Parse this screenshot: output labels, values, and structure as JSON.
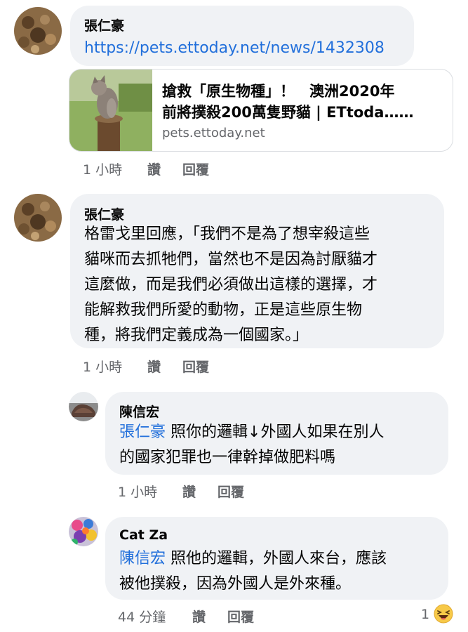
{
  "comments": [
    {
      "author": "張仁豪",
      "link": "https://pets.ettoday.net/news/1432308",
      "preview": {
        "title_line1": "搶救「原生物種」！　澳洲2020年",
        "title_line2": "前將撲殺200萬隻野貓 | ETtoda……",
        "domain": "pets.ettoday.net"
      },
      "time": "1 小時",
      "like_label": "讚",
      "reply_label": "回覆"
    },
    {
      "author": "張仁豪",
      "lines": [
        "格雷戈里回應，「我們不是為了想宰殺這些",
        "貓咪而去抓牠們，當然也不是因為討厭貓才",
        "這麼做，而是我們必須做出這樣的選擇，才",
        "能解救我們所愛的動物，正是這些原生物",
        "種，將我們定義成為一個國家。」"
      ],
      "time": "1 小時",
      "like_label": "讚",
      "reply_label": "回覆"
    }
  ],
  "replies": [
    {
      "author": "陳信宏",
      "mention": "張仁豪",
      "line1_rest": " 照你的邏輯↓外國人如果在別人",
      "line2": "的國家犯罪也一律幹掉做肥料嗎",
      "time": "1 小時",
      "like_label": "讚",
      "reply_label": "回覆"
    },
    {
      "author": "Cat Za",
      "mention": "陳信宏",
      "line1_rest": " 照他的邏輯，外國人來台，應該",
      "line2": "被他撲殺，因為外國人是外來種。",
      "time": "44 分鐘",
      "like_label": "讚",
      "reply_label": "回覆",
      "reaction_count": "1",
      "reaction_icon": "laughing-emoji-icon"
    }
  ],
  "colors": {
    "bubble": "#f0f2f5",
    "link": "#216fdb",
    "meta": "#65676b",
    "text": "#050505"
  }
}
